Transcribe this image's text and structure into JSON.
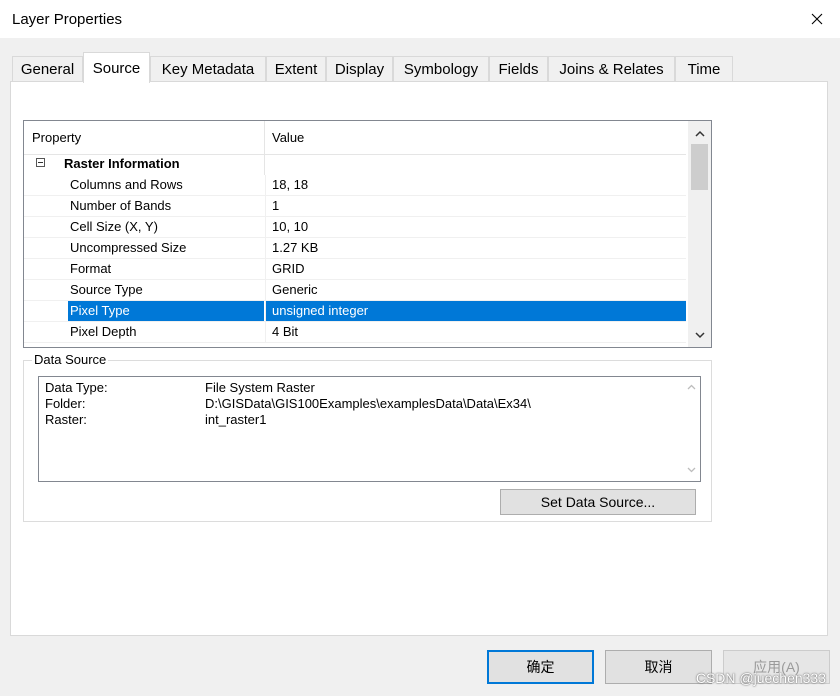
{
  "window": {
    "title": "Layer Properties"
  },
  "tabs": [
    {
      "label": "General"
    },
    {
      "label": "Source"
    },
    {
      "label": "Key Metadata"
    },
    {
      "label": "Extent"
    },
    {
      "label": "Display"
    },
    {
      "label": "Symbology"
    },
    {
      "label": "Fields"
    },
    {
      "label": "Joins & Relates"
    },
    {
      "label": "Time"
    }
  ],
  "active_tab": "Source",
  "property_grid": {
    "headers": {
      "property": "Property",
      "value": "Value"
    },
    "category": "Raster Information",
    "rows": [
      {
        "property": "Columns and Rows",
        "value": "18, 18"
      },
      {
        "property": "Number of Bands",
        "value": "1"
      },
      {
        "property": "Cell Size (X, Y)",
        "value": "10, 10"
      },
      {
        "property": "Uncompressed Size",
        "value": "1.27 KB"
      },
      {
        "property": "Format",
        "value": "GRID"
      },
      {
        "property": "Source Type",
        "value": "Generic"
      },
      {
        "property": "Pixel Type",
        "value": "unsigned integer"
      },
      {
        "property": "Pixel Depth",
        "value": "4 Bit"
      }
    ],
    "selected_row": "Pixel Type"
  },
  "data_source": {
    "group_label": "Data Source",
    "lines": [
      {
        "key": "Data Type:",
        "value": "File System Raster"
      },
      {
        "key": "Folder:",
        "value": "D:\\GISData\\GIS100Examples\\examplesData\\Data\\Ex34\\"
      },
      {
        "key": "Raster:",
        "value": "int_raster1"
      }
    ],
    "set_button_label": "Set Data Source..."
  },
  "footer": {
    "ok_label": "确定",
    "cancel_label": "取消",
    "apply_label": "应用(A)"
  },
  "watermark": "CSDN @juechen333",
  "colors": {
    "selection": "#0078d7",
    "default_button_border": "#0078d7"
  }
}
